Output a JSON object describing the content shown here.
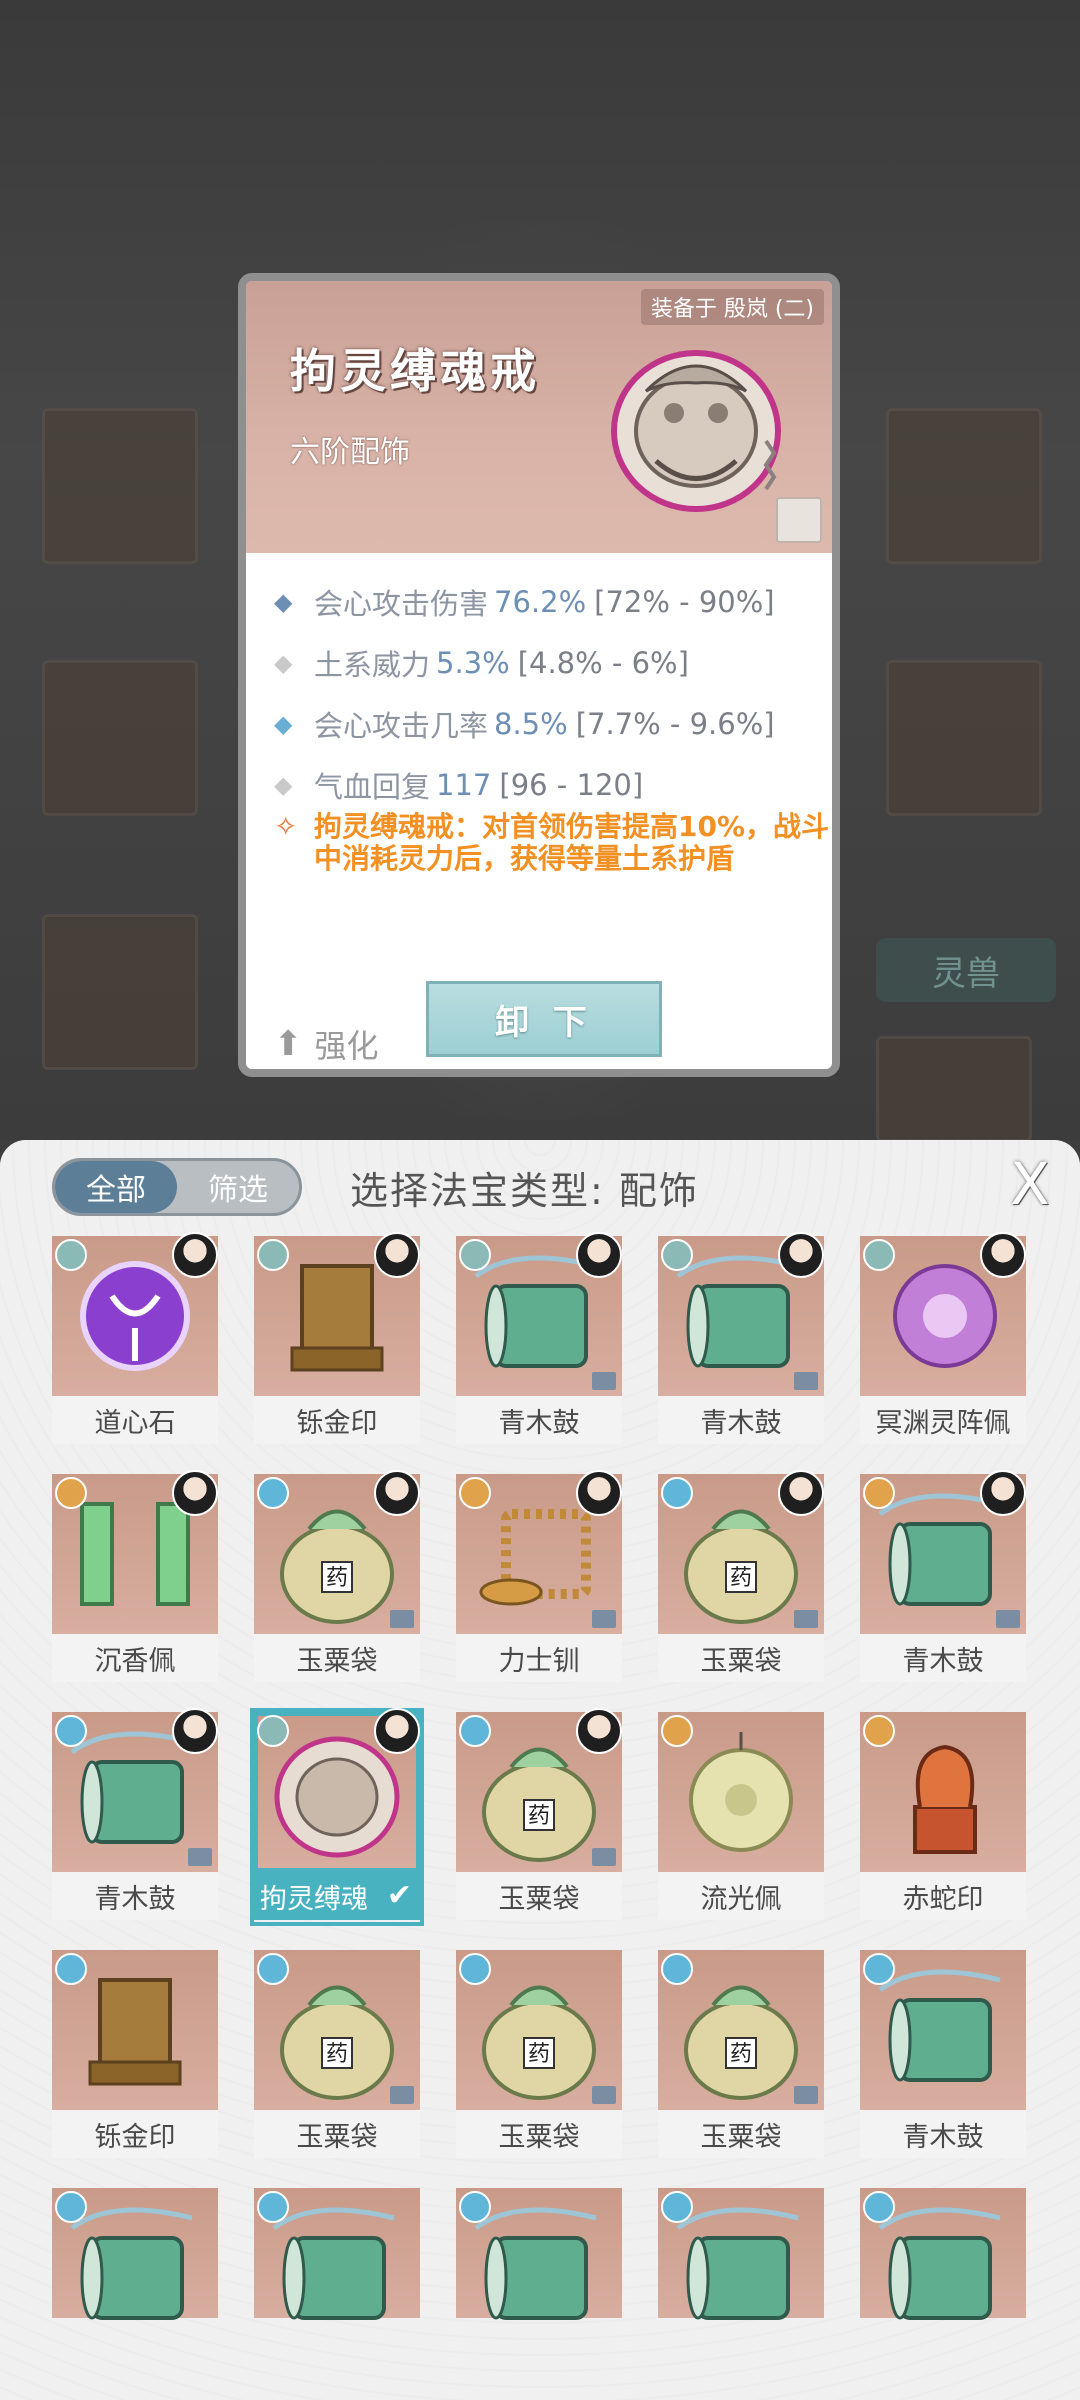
{
  "popup": {
    "equipped_on": "装备于 殷岚 (二)",
    "item_name": "拘灵缚魂戒",
    "item_grade": "六阶配饰",
    "stats": [
      {
        "name": "会心攻击伤害",
        "value": "76.2%",
        "range": "[72% - 90%]",
        "marker": "◆",
        "marker_color": "#6c8fb3"
      },
      {
        "name": "土系威力",
        "value": "5.3%",
        "range": "[4.8% - 6%]",
        "marker": "◆",
        "marker_color": "#c9c9c9"
      },
      {
        "name": "会心攻击几率",
        "value": "8.5%",
        "range": "[7.7% - 9.6%]",
        "marker": "◆",
        "marker_color": "#6aaed6"
      },
      {
        "name": "气血回复",
        "value": "117",
        "range": "[96 - 120]",
        "marker": "◆",
        "marker_color": "#c9c9c9"
      }
    ],
    "special_mark": "✧",
    "special_text": "拘灵缚魂戒：对首领伤害提高10%，战斗中消耗灵力后，获得等量土系护盾",
    "enhance_label": "强化",
    "unload_label": "卸 下"
  },
  "background": {
    "tab_label": "灵兽"
  },
  "panel": {
    "filter_all": "全部",
    "filter_screen": "筛选",
    "title": "选择法宝类型: 配饰",
    "close_label": "X",
    "items": [
      {
        "label": "道心石",
        "bead": "default",
        "portrait": true,
        "tag": false,
        "art": "purple-orb"
      },
      {
        "label": "铄金印",
        "bead": "default",
        "portrait": true,
        "tag": false,
        "art": "gold-seal"
      },
      {
        "label": "青木鼓",
        "bead": "default",
        "portrait": true,
        "tag": true,
        "art": "green-drum"
      },
      {
        "label": "青木鼓",
        "bead": "default",
        "portrait": true,
        "tag": true,
        "art": "green-drum"
      },
      {
        "label": "冥渊灵阵佩",
        "bead": "default",
        "portrait": true,
        "tag": false,
        "art": "purple-pendant"
      },
      {
        "label": "沉香佩",
        "bead": "gold",
        "portrait": true,
        "tag": false,
        "art": "jade-pendant"
      },
      {
        "label": "玉粟袋",
        "bead": "blue",
        "portrait": true,
        "tag": true,
        "art": "herb-bag"
      },
      {
        "label": "力士钏",
        "bead": "gold",
        "portrait": true,
        "tag": true,
        "art": "gold-coil"
      },
      {
        "label": "玉粟袋",
        "bead": "blue",
        "portrait": true,
        "tag": true,
        "art": "herb-bag"
      },
      {
        "label": "青木鼓",
        "bead": "gold",
        "portrait": true,
        "tag": true,
        "art": "green-drum"
      },
      {
        "label": "青木鼓",
        "bead": "blue",
        "portrait": true,
        "tag": true,
        "art": "green-drum"
      },
      {
        "label": "拘灵缚魂",
        "bead": "default",
        "portrait": true,
        "tag": false,
        "art": "ring",
        "selected": true
      },
      {
        "label": "玉粟袋",
        "bead": "blue",
        "portrait": true,
        "tag": true,
        "art": "herb-bag"
      },
      {
        "label": "流光佩",
        "bead": "gold",
        "portrait": false,
        "tag": false,
        "art": "jade-disc"
      },
      {
        "label": "赤蛇印",
        "bead": "gold",
        "portrait": false,
        "tag": false,
        "art": "snake-seal"
      },
      {
        "label": "铄金印",
        "bead": "blue",
        "portrait": false,
        "tag": false,
        "art": "gold-seal"
      },
      {
        "label": "玉粟袋",
        "bead": "blue",
        "portrait": false,
        "tag": true,
        "art": "herb-bag"
      },
      {
        "label": "玉粟袋",
        "bead": "blue",
        "portrait": false,
        "tag": true,
        "art": "herb-bag"
      },
      {
        "label": "玉粟袋",
        "bead": "blue",
        "portrait": false,
        "tag": true,
        "art": "herb-bag"
      },
      {
        "label": "青木鼓",
        "bead": "blue",
        "portrait": false,
        "tag": false,
        "art": "green-drum"
      },
      {
        "label": "",
        "bead": "blue",
        "portrait": false,
        "tag": false,
        "art": "green-drum",
        "partial": true
      },
      {
        "label": "",
        "bead": "blue",
        "portrait": false,
        "tag": false,
        "art": "green-drum",
        "partial": true
      },
      {
        "label": "",
        "bead": "blue",
        "portrait": false,
        "tag": false,
        "art": "green-drum",
        "partial": true
      },
      {
        "label": "",
        "bead": "blue",
        "portrait": false,
        "tag": false,
        "art": "green-drum",
        "partial": true
      },
      {
        "label": "",
        "bead": "blue",
        "portrait": false,
        "tag": false,
        "art": "green-drum",
        "partial": true
      }
    ]
  }
}
